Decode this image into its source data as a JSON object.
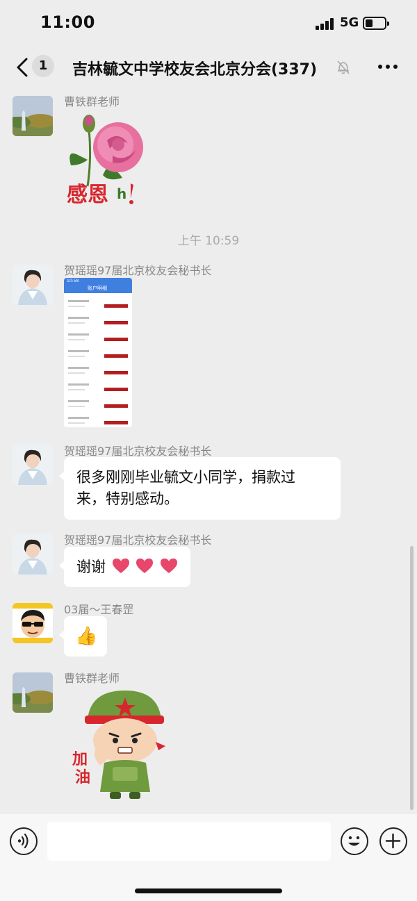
{
  "status_bar": {
    "time": "11:00",
    "network": "5G"
  },
  "nav": {
    "unread_count": "1",
    "title": "吉林毓文中学校友会北京分会(337)"
  },
  "timestamp": "上午 10:59",
  "messages": [
    {
      "sender": "曹铁群老师",
      "type": "sticker",
      "sticker_caption": "感恩",
      "sticker_suffix": "h"
    },
    {
      "sender": "贺瑶瑶97届北京校友会秘书长",
      "type": "image",
      "screenshot_title": "账户明细",
      "screenshot_time": "10:58"
    },
    {
      "sender": "贺瑶瑶97届北京校友会秘书长",
      "type": "text",
      "text_line1": "很多刚刚毕业毓文小同学，捐款过",
      "text_line2": "来，特别感动。"
    },
    {
      "sender": "贺瑶瑶97届北京校友会秘书长",
      "type": "text",
      "text": "谢谢"
    },
    {
      "sender": "03届～王春罡",
      "type": "emoji",
      "emoji": "👍"
    },
    {
      "sender": "曹铁群老师",
      "type": "sticker",
      "sticker_caption_1": "加",
      "sticker_caption_2": "油"
    }
  ],
  "colors": {
    "background": "#ededed",
    "bubble": "#ffffff",
    "heart": "#e8466b",
    "rose": "#e15a8c",
    "soldier": "#6f9a3e",
    "star": "#d8262d"
  }
}
